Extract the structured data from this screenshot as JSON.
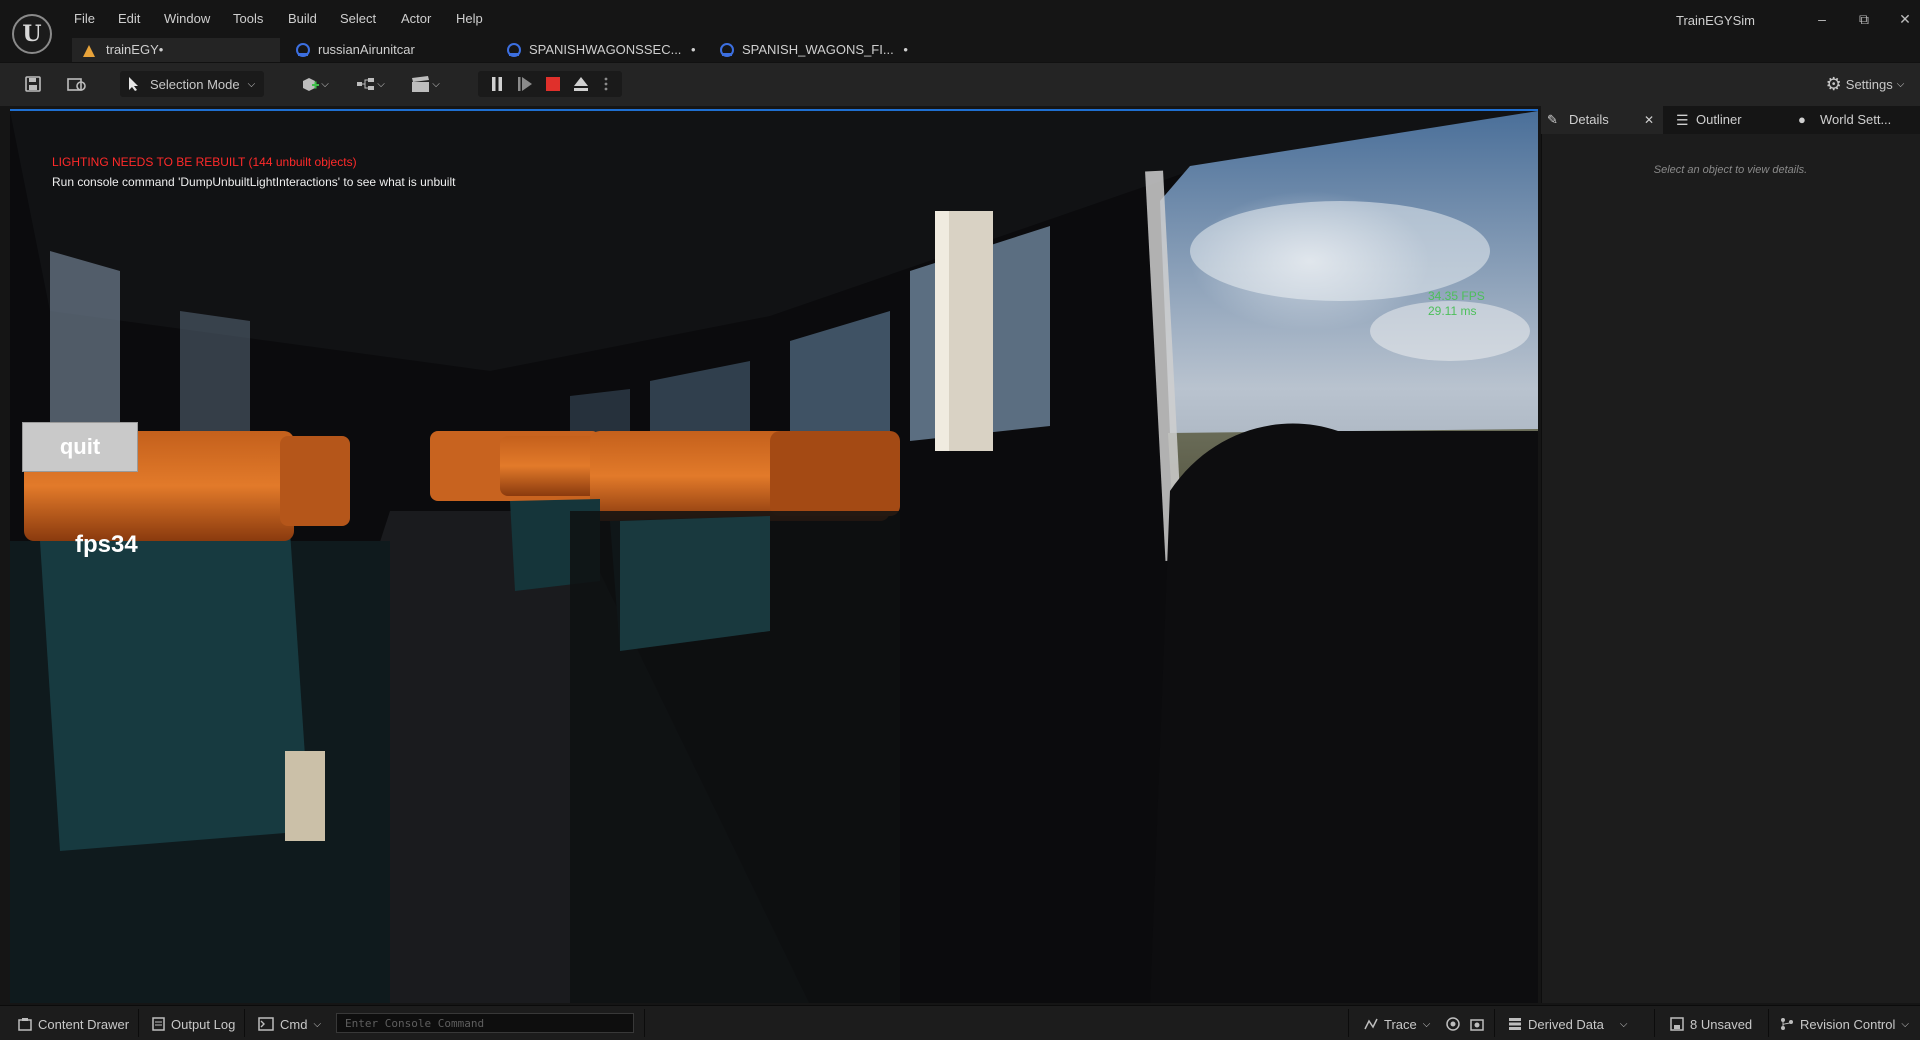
{
  "app": {
    "title": "TrainEGYSim"
  },
  "menu": [
    "File",
    "Edit",
    "Window",
    "Tools",
    "Build",
    "Select",
    "Actor",
    "Help"
  ],
  "tabs": [
    {
      "label": "trainEGY•",
      "icon": "level-icon",
      "active": true
    },
    {
      "label": "russianAirunitcar",
      "icon": "blueprint-icon"
    },
    {
      "label": "SPANISHWAGONSSEC...",
      "modified": "•",
      "icon": "blueprint-icon"
    },
    {
      "label": "SPANISH_WAGONS_FI...",
      "modified": "•",
      "icon": "blueprint-icon"
    }
  ],
  "toolbar": {
    "selection_mode": "Selection Mode",
    "settings": "Settings"
  },
  "viewport": {
    "warning": "LIGHTING NEEDS TO BE REBUILT (144 unbuilt objects)",
    "info": "Run console command 'DumpUnbuiltLightInteractions' to see what is unbuilt",
    "stats_fps": "34.35 FPS",
    "stats_ms": "29.11 ms",
    "quit_label": "quit",
    "fps_label": "fps34"
  },
  "panel": {
    "tabs": [
      "Details",
      "Outliner",
      "World Sett..."
    ],
    "hint": "Select an object to view details."
  },
  "statusbar": {
    "content_drawer": "Content Drawer",
    "output_log": "Output Log",
    "cmd": "Cmd",
    "console_placeholder": "Enter Console Command",
    "trace": "Trace",
    "derived_data": "Derived Data",
    "unsaved": "8 Unsaved",
    "revision_control": "Revision Control"
  },
  "colors": {
    "accent_blue": "#1f6fd1",
    "warning_red": "#ff2a2a",
    "stats_green": "#4dbf5a",
    "stop_red": "#e0302b",
    "level_icon_orange": "#e8a33a"
  }
}
